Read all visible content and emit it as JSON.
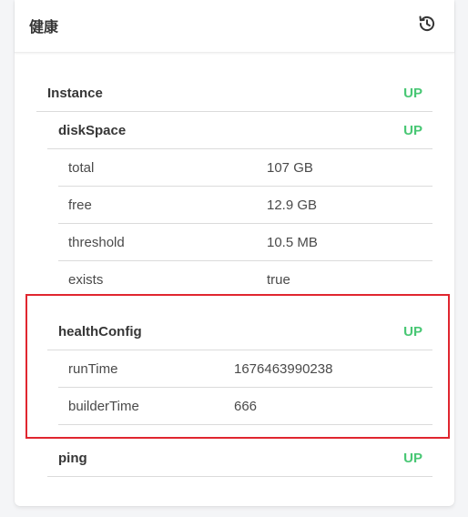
{
  "header": {
    "title": "健康",
    "history_icon": "history-icon"
  },
  "instance": {
    "label": "Instance",
    "status": "UP"
  },
  "diskSpace": {
    "label": "diskSpace",
    "status": "UP",
    "details": [
      {
        "key": "total",
        "value": "107 GB"
      },
      {
        "key": "free",
        "value": "12.9 GB"
      },
      {
        "key": "threshold",
        "value": "10.5 MB"
      },
      {
        "key": "exists",
        "value": "true"
      }
    ]
  },
  "healthConfig": {
    "label": "healthConfig",
    "status": "UP",
    "details": [
      {
        "key": "runTime",
        "value": "1676463990238"
      },
      {
        "key": "builderTime",
        "value": "666"
      }
    ]
  },
  "ping": {
    "label": "ping",
    "status": "UP"
  },
  "colors": {
    "status_up": "#48c774",
    "highlight_border": "#e0262f"
  }
}
